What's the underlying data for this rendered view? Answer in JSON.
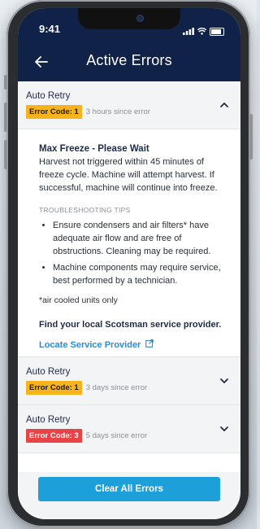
{
  "status_bar": {
    "time": "9:41"
  },
  "header": {
    "title": "Active Errors"
  },
  "errors": [
    {
      "type": "Auto Retry",
      "code": "Error Code: 1",
      "since": "3 hours since error",
      "badge_color": "#f6b31c",
      "expanded": true
    },
    {
      "type": "Auto Retry",
      "code": "Error Code: 1",
      "since": "3 days since error",
      "badge_color": "#f6b31c",
      "expanded": false
    },
    {
      "type": "Auto Retry",
      "code": "Error Code: 3",
      "since": "5 days since error",
      "badge_color": "#e84346",
      "expanded": false
    }
  ],
  "details": {
    "title": "Max Freeze - Please Wait",
    "description": "Harvest not triggered within 45 minutes of freeze cycle. Machine will attempt harvest. If successful, machine will continue into freeze.",
    "tips_label": "TROUBLESHOOTING TIPS",
    "tips": [
      "Ensure condensers and air filters* have adequate air flow and are free of obstructions. Cleaning may be required.",
      "Machine components may require service, best performed by a technician."
    ],
    "note": "*air cooled units only",
    "find_text": "Find your local Scotsman service provider.",
    "locate_link": "Locate Service Provider"
  },
  "actions": {
    "clear_all": "Clear All Errors"
  },
  "colors": {
    "header_bg": "#102247",
    "accent": "#1d9fd9",
    "link": "#2d8ccf"
  }
}
